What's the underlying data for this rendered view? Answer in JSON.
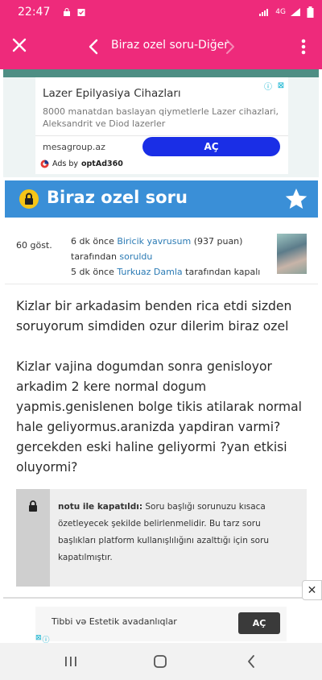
{
  "status_bar": {
    "time": "22:47",
    "network": "4G",
    "signal_label": "LTE"
  },
  "app_bar": {
    "title": "Biraz ozel soru-Diğer"
  },
  "top_ad": {
    "title": "Lazer Epilyasiya Cihazları",
    "description": "8000 manatdan baslayan qiymetlerle Lazer cihazlari, Aleksandrit ve Diod lazerler",
    "domain": "mesagroup.az",
    "cta_label": "AÇ",
    "ads_by_prefix": "Ads by",
    "ads_by_brand": "optAd360"
  },
  "question_header": {
    "title": "Biraz ozel soru"
  },
  "meta": {
    "views": "60 göst.",
    "asked_time": "6 dk önce",
    "asker_name": "Biricik yavrusum",
    "asker_points": "(937 puan)",
    "asked_by_text": "tarafından",
    "asked_verb": "soruldu",
    "closed_time": "5 dk önce",
    "closer_name": "Turkuaz Damla",
    "closed_text": "tarafından kapalı"
  },
  "question": {
    "paragraph_1": "Kizlar bir arkadasim benden rica etdi sizden soruyorum simdiden ozur dilerim biraz ozel",
    "paragraph_2": "Kizlar vajina dogumdan sonra genisloyor arkadim 2 kere normal dogum yapmis.genislenen bolge tikis atilarak normal hale geliyormus.aranizda yapdiran varmi? gercekden eski haline geliyormi ?yan etkisi oluyormi?"
  },
  "closed_note": {
    "label": "notu ile kapatıldı:",
    "text": "Soru başlığı sorunuzu kısaca özetleyecek şekilde belirlenmelidir. Bu tarz soru başlıkları platform kullanışlılığını azalttığı için soru kapatılmıştır."
  },
  "bottom_ad": {
    "text": "Tibbi və Estetik avadanlıqlar",
    "cta_label": "AÇ",
    "close_label": "✕"
  },
  "colors": {
    "brand_pink": "#ee2a7b",
    "header_blue": "#3a8fd7",
    "link_blue": "#2a7ab4",
    "ad_button_blue": "#1a2ee6"
  }
}
